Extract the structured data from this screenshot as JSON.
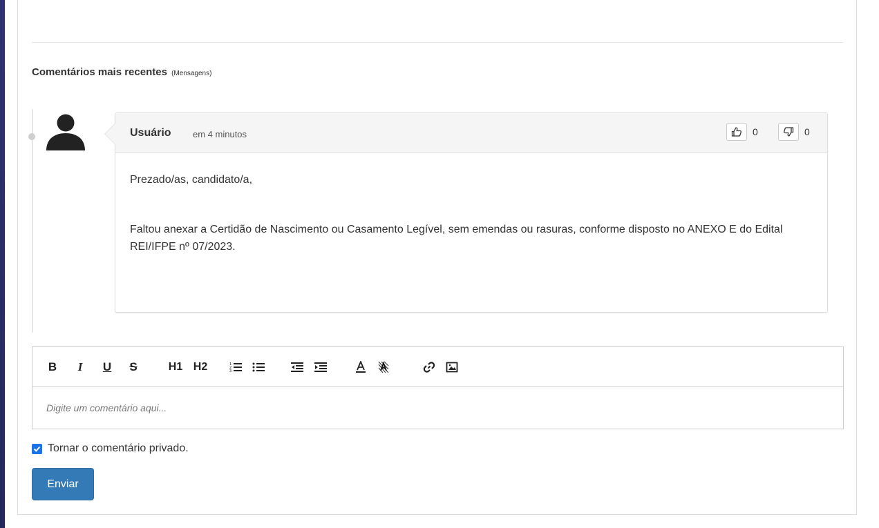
{
  "section": {
    "title": "Comentários mais recentes",
    "subtitle": "(Mensagens)"
  },
  "comment": {
    "author": "Usuário",
    "time": "em 4 minutos",
    "likes": "0",
    "dislikes": "0",
    "paragraphs": [
      "Prezado/as, candidato/a,",
      "Faltou anexar a Certidão de Nascimento ou Casamento Legível, sem emendas ou rasuras, conforme disposto no ANEXO E do Edital REI/IFPE nº 07/2023."
    ]
  },
  "editor": {
    "toolbar": {
      "bold": "B",
      "italic": "I",
      "underline": "U",
      "strike": "S",
      "h1": "H1",
      "h2": "H2"
    },
    "placeholder": "Digite um comentário aqui..."
  },
  "private_label": "Tornar o comentário privado.",
  "private_checked": true,
  "submit_label": "Enviar",
  "colors": {
    "primary": "#337ab7",
    "checkbox": "#1a73e8",
    "background": "#2b2f6b"
  }
}
